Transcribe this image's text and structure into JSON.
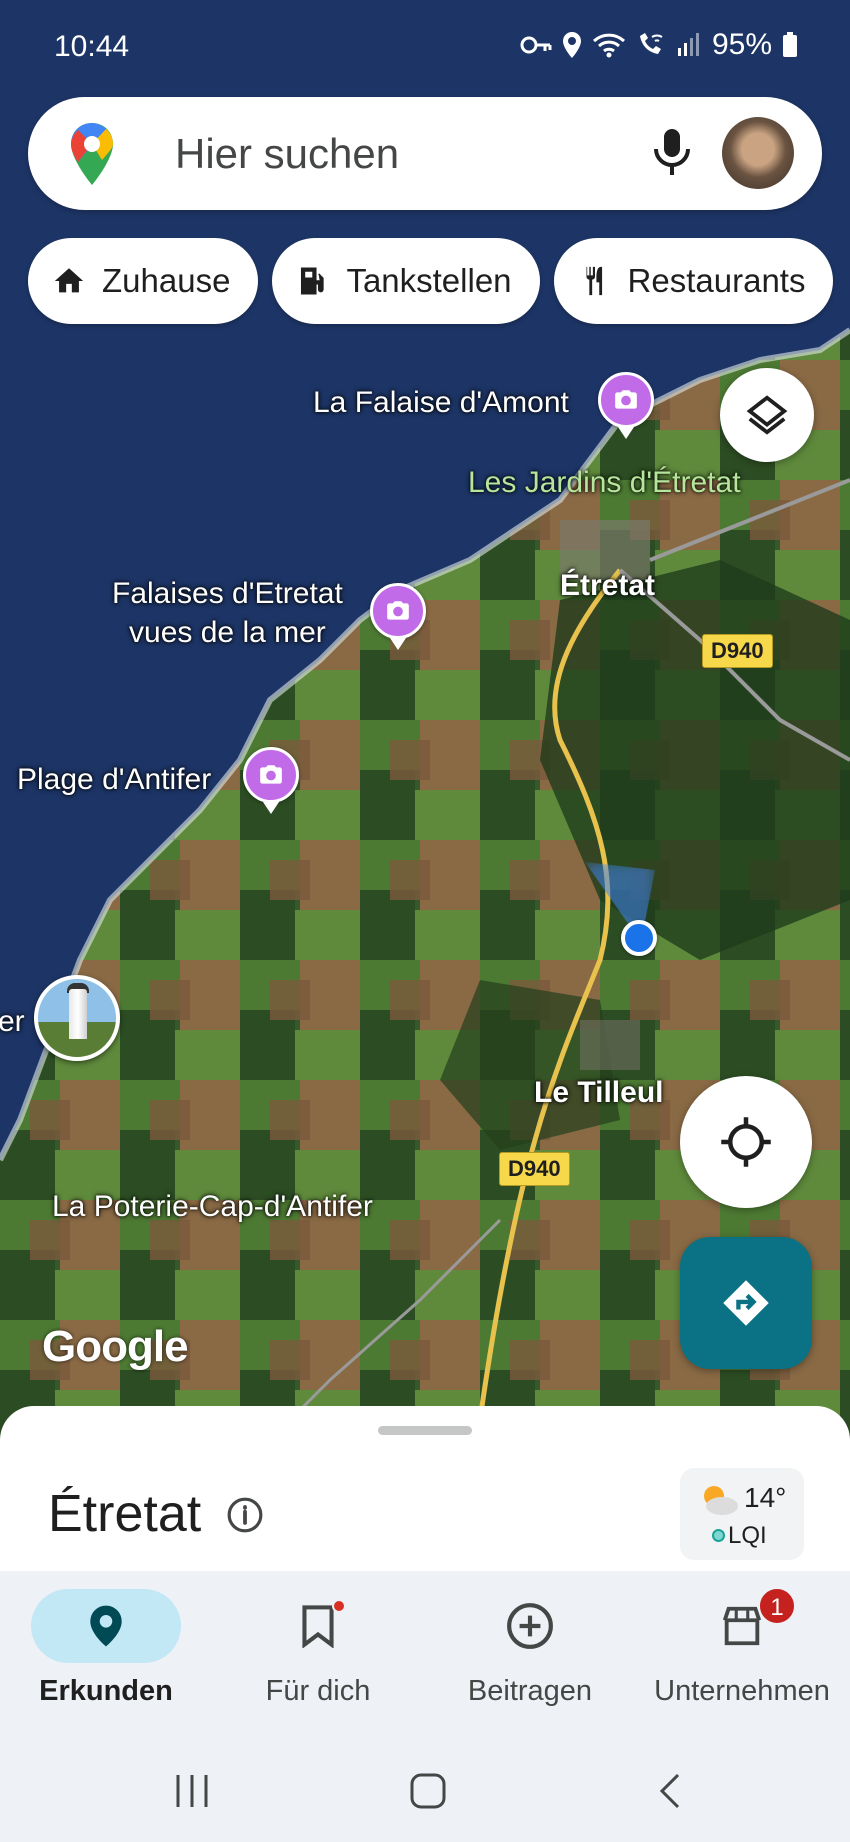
{
  "status_bar": {
    "time": "10:44",
    "battery": "95%",
    "icons": [
      "vpn-key-icon",
      "location-icon",
      "wifi-icon",
      "wifi-call-icon",
      "signal-icon",
      "battery-icon"
    ]
  },
  "search": {
    "placeholder": "Hier suchen",
    "icons": [
      "maps-logo-icon",
      "microphone-icon",
      "avatar"
    ]
  },
  "chips": [
    {
      "label": "Zuhause",
      "icon": "home-icon"
    },
    {
      "label": "Tankstellen",
      "icon": "gas-station-icon"
    },
    {
      "label": "Restaurants",
      "icon": "restaurant-icon"
    }
  ],
  "map": {
    "labels": {
      "falaise_amont": "La Falaise d'Amont",
      "jardins": "Les Jardins d'Étretat",
      "etretat": "Étretat",
      "falaises_vues_1": "Falaises d'Etretat",
      "falaises_vues_2": "vues de la mer",
      "plage_antifer": "Plage d'Antifer",
      "partial_left": "er",
      "le_tilleul": "Le Tilleul",
      "poterie": "La Poterie-Cap-d'Antifer"
    },
    "roads": {
      "d940_a": "D940",
      "d940_b": "D940"
    },
    "brand": "Google",
    "colors": {
      "sea": "#1d3566",
      "land_dark": "#2d4a22",
      "photo_pin": "#c26be8",
      "my_location": "#1a73e8",
      "directions": "#0b7285"
    }
  },
  "sheet": {
    "title": "Étretat",
    "weather": {
      "temp": "14°",
      "aqi_label": "LQI"
    }
  },
  "bottom_nav": [
    {
      "label": "Erkunden",
      "icon": "explore-pin-icon",
      "active": true
    },
    {
      "label": "Für dich",
      "icon": "bookmark-icon",
      "badge_dot": true
    },
    {
      "label": "Beitragen",
      "icon": "add-circle-icon"
    },
    {
      "label": "Unternehmen",
      "icon": "storefront-icon",
      "badge_count": "1"
    }
  ]
}
